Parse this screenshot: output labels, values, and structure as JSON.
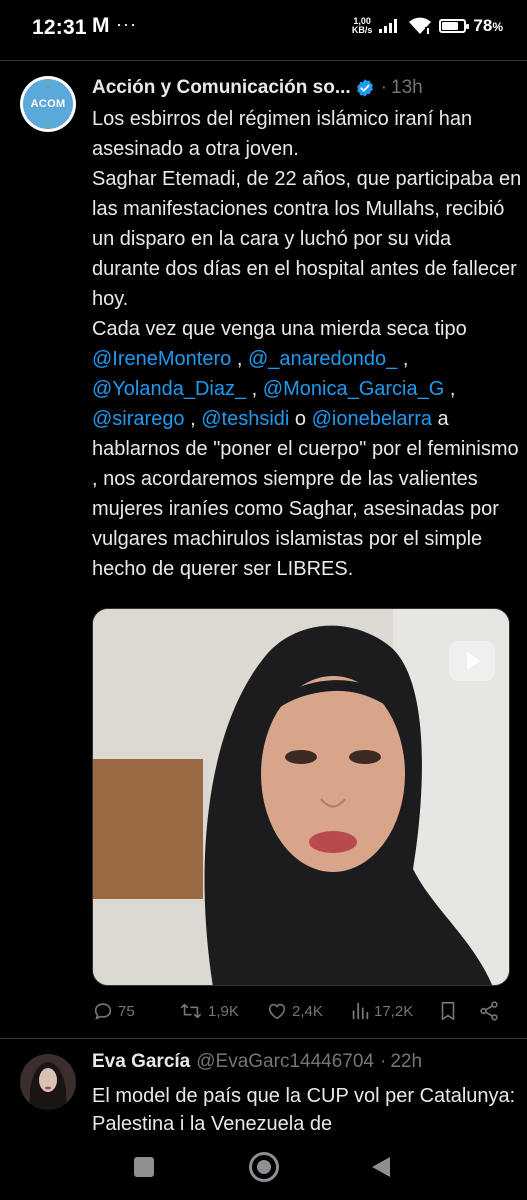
{
  "status_bar": {
    "time": "12:31",
    "mc_icon": "M",
    "dots": "···",
    "speed_value": "1,00",
    "speed_unit": "KB/s",
    "battery": "78",
    "battery_unit": "%",
    "battery_level": 0.78
  },
  "tweet": {
    "author_name": "Acción y Comunicación so...",
    "avatar_text": "ACOM",
    "verified": true,
    "time": "13h",
    "text_parts": [
      "Los esbirros del régimen islámico iraní han asesinado a otra joven.\nSaghar Etemadi, de 22 años, que participaba en las manifestaciones contra los Mullahs, recibió un disparo en la cara y luchó por su vida durante dos días en el hospital antes de fallecer hoy.\nCada vez que venga una mierda seca tipo ",
      " , ",
      " ,\n",
      " , ",
      " ,\n",
      " , ",
      " o ",
      " a hablarnos de \"poner el cuerpo\" por el feminismo , nos acordaremos siempre de las valientes mujeres iraníes como Saghar, asesinadas por vulgares machirulos islamistas por el simple hecho de querer ser LIBRES."
    ],
    "mentions": [
      "@IreneMontero",
      "@_anaredondo_",
      "@Yolanda_Diaz_",
      "@Monica_Garcia_G",
      "@sirarego",
      "@teshsidi",
      "@ionebelarra"
    ],
    "stats": {
      "replies": "75",
      "retweets": "1,9K",
      "likes": "2,4K",
      "views": "17,2K"
    }
  },
  "tweet2": {
    "author_name": "Eva García",
    "handle": "@EvaGarc14446704",
    "time": "22h",
    "text": "El model de país que la CUP vol per Catalunya: Palestina i la Venezuela de"
  },
  "colors": {
    "background": "#000000",
    "text": "#e7e9ea",
    "muted": "#71767b",
    "link": "#1d9bf0",
    "verified": "#1d9bf0"
  }
}
